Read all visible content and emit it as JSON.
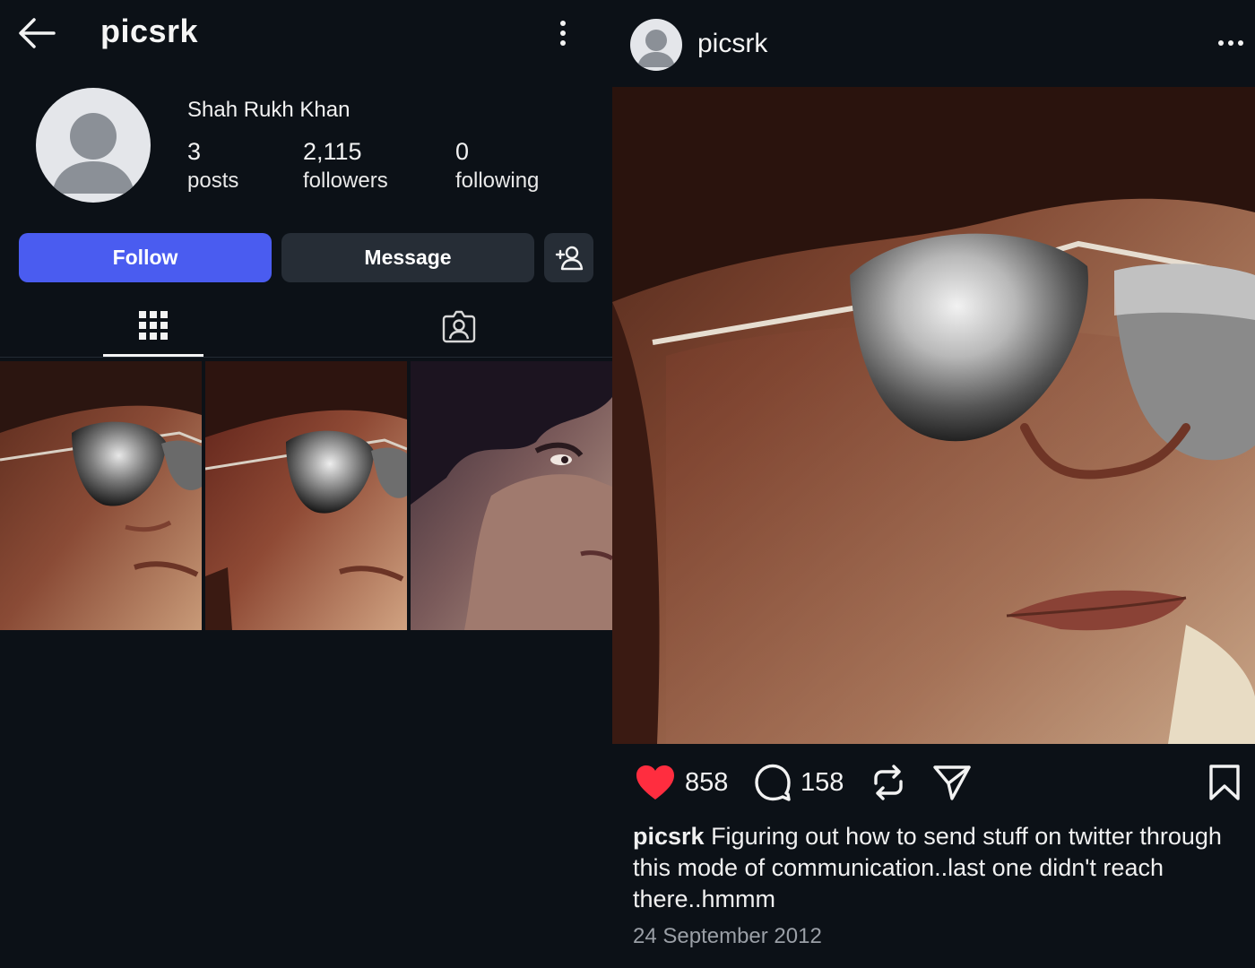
{
  "profile": {
    "handle": "picsrk",
    "display_name": "Shah Rukh Khan",
    "stats": [
      {
        "value": "3",
        "label": "posts"
      },
      {
        "value": "2,115",
        "label": "followers"
      },
      {
        "value": "0",
        "label": "following"
      }
    ],
    "buttons": {
      "follow": "Follow",
      "message": "Message"
    },
    "tabs": [
      "grid-icon",
      "tagged-icon"
    ],
    "active_tab": "grid-icon",
    "thumbnails": 3
  },
  "post": {
    "username": "picsrk",
    "likes": "858",
    "comments": "158",
    "caption_user": "picsrk",
    "caption_text": " Figuring out how to send stuff on twitter through this mode of communication..last one didn't reach there..hmmm",
    "date": "24 September 2012"
  },
  "colors": {
    "background": "#0c1117",
    "follow_button": "#4a5cf0",
    "secondary_button": "#262d36",
    "like_heart": "#ff2d3f",
    "date_text": "#9a9fa6"
  },
  "icons": [
    "back-arrow-icon",
    "kebab-menu-icon",
    "add-user-icon",
    "grid-icon",
    "tagged-icon",
    "more-icon",
    "heart-icon",
    "comment-icon",
    "repost-icon",
    "share-icon",
    "bookmark-icon"
  ]
}
